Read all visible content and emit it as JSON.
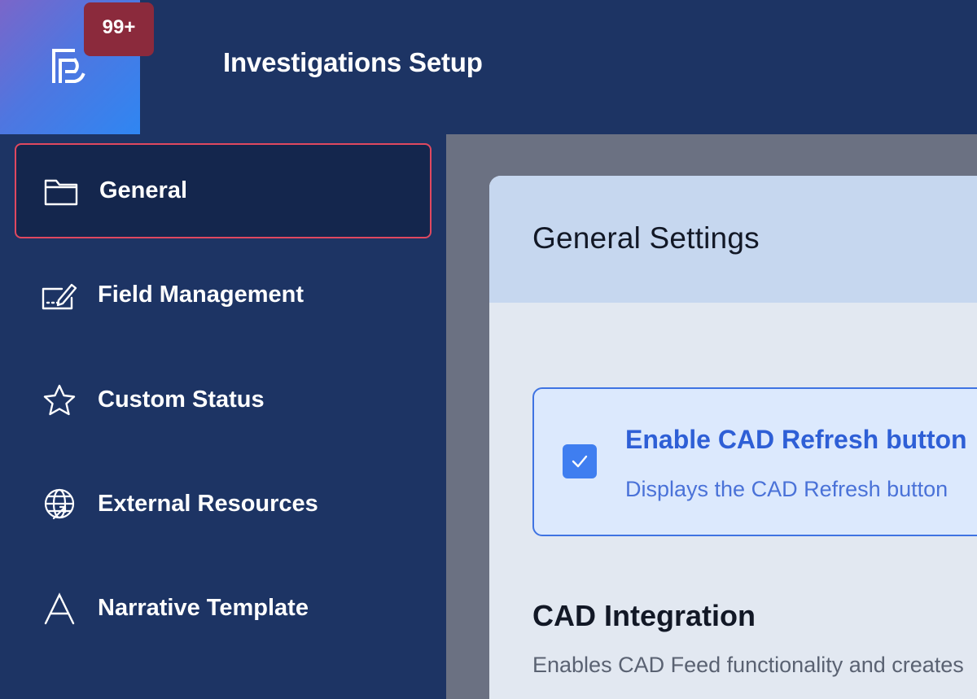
{
  "header": {
    "app_title": "Investigations Setup",
    "notification_count": "99+",
    "logo_icon": "app-logo-icon"
  },
  "sidebar": {
    "items": [
      {
        "label": "General",
        "icon": "folder-icon",
        "active": true
      },
      {
        "label": "Field Management",
        "icon": "form-edit-icon",
        "active": false
      },
      {
        "label": "Custom Status",
        "icon": "star-icon",
        "active": false
      },
      {
        "label": "External Resources",
        "icon": "globe-link-icon",
        "active": false
      },
      {
        "label": "Narrative Template",
        "icon": "letter-a-icon",
        "active": false
      }
    ]
  },
  "main": {
    "card_title": "General Settings",
    "option": {
      "checked": true,
      "title": "Enable CAD Refresh button",
      "description": "Displays the CAD Refresh button"
    },
    "section": {
      "title": "CAD Integration",
      "description": "Enables CAD Feed functionality and creates"
    }
  },
  "colors": {
    "background": "#1d3464",
    "active_border": "#e04860",
    "badge": "#8b2a3c",
    "accent": "#3f7ef0"
  }
}
